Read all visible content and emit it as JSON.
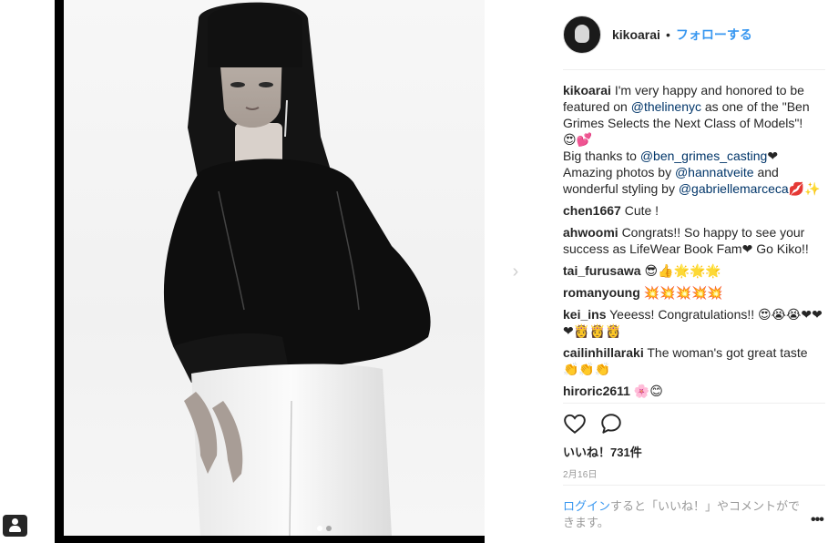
{
  "post": {
    "username": "kikoarai",
    "separator": "•",
    "follow_label": "フォローする",
    "caption": {
      "line1_a": "I'm very happy and honored to be featured on ",
      "mention1": "@thelinenyc",
      "line1_b": " as one of the \"Ben Grimes Selects the Next Class of Models\"!",
      "emoji1": "😍💕",
      "line2_a": "Big thanks to ",
      "mention2": "@ben_grimes_casting",
      "line2_b": "❤Amazing photos by ",
      "mention3": "@hannatveite",
      "line2_c": " and wonderful styling by ",
      "mention4": "@gabriellemarceca",
      "emoji2": "💋✨"
    },
    "comments": [
      {
        "user": "chen1667",
        "text": "Cute !"
      },
      {
        "user": "ahwoomi",
        "text": "Congrats!! So happy to see your success as LifeWear Book Fam❤ Go Kiko!!"
      },
      {
        "user": "tai_furusawa",
        "text": "😎👍🌟🌟🌟"
      },
      {
        "user": "romanyoung",
        "text": "💥💥💥💥💥"
      },
      {
        "user": "kei_ins",
        "text": "Yeeess! Congratulations!! 😍😭😭❤❤❤👸👸👸"
      },
      {
        "user": "cailinhillaraki",
        "text": "The woman's got great taste 👏👏👏"
      },
      {
        "user": "hiroric2611",
        "text": "🌸😊"
      }
    ],
    "likes_label": "いいね！731件",
    "date": "2月16日",
    "login_link": "ログイン",
    "login_rest": "すると「いいね！」やコメントができます。",
    "more_label": "•••"
  },
  "carousel": {
    "next_arrow": "›",
    "dots_count": 2,
    "active_dot": 0
  },
  "icons": {
    "like": "heart-outline-icon",
    "comment": "speech-bubble-icon",
    "next": "chevron-right-icon",
    "more": "more-horizontal-icon",
    "side": "user-silhouette-icon"
  },
  "colors": {
    "link_blue": "#3897f0",
    "mention_blue": "#003569",
    "text": "#262626",
    "muted": "#999999"
  }
}
